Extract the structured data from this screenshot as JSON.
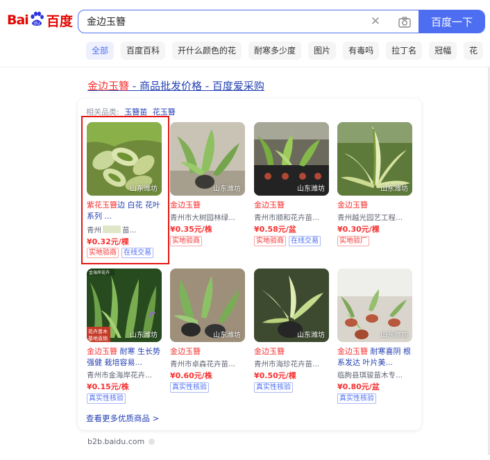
{
  "header": {
    "logo_bai": "Bai",
    "logo_du": "百度",
    "search_value": "金边玉簪",
    "search_button": "百度一下"
  },
  "tabs": [
    "全部",
    "百度百科",
    "开什么颜色的花",
    "耐寒多少度",
    "图片",
    "有毒吗",
    "拉丁名",
    "冠幅",
    "花"
  ],
  "result": {
    "title_highlight": "金边玉簪",
    "title_rest": " - 商品批发价格 - 百度爱采购",
    "related_label": "相关品类:",
    "related_items": [
      "玉簪苗",
      "花玉簪"
    ],
    "products": [
      {
        "name_red": "紫花玉簪",
        "name_rest": "边 白花 花叶系列 ...",
        "seller": "青州",
        "seller_tail": "苗...",
        "price": "¥0.32元/棵",
        "location": "山东潍坊",
        "badges": [
          {
            "text": "实地验商",
            "type": "r"
          },
          {
            "text": "在线交易",
            "type": "b"
          }
        ]
      },
      {
        "name_red": "金边玉簪",
        "name_rest": "",
        "seller": "青州市大树园林绿...",
        "price": "¥0.35元/株",
        "location": "山东潍坊",
        "badges": [
          {
            "text": "实地验商",
            "type": "r"
          }
        ]
      },
      {
        "name_red": "金边玉簪",
        "name_rest": "",
        "seller": "青州市顺和花卉苗...",
        "price": "¥0.58元/盆",
        "location": "山东潍坊",
        "badges": [
          {
            "text": "实地验商",
            "type": "r"
          },
          {
            "text": "在线交易",
            "type": "b"
          }
        ]
      },
      {
        "name_red": "金边玉簪",
        "name_rest": "",
        "seller": "青州越光园艺工程...",
        "price": "¥0.30元/棵",
        "location": "山东潍坊",
        "badges": [
          {
            "text": "实地验厂",
            "type": "r"
          }
        ]
      },
      {
        "name_red": "金边玉簪",
        "name_rest": " 耐寒 生长势强健 栽培容易...",
        "seller": "青州市金海岸花卉...",
        "price": "¥0.15元/株",
        "location": "山东潍坊",
        "badges": [
          {
            "text": "真实性核验",
            "type": "b"
          }
        ]
      },
      {
        "name_red": "金边玉簪",
        "name_rest": "",
        "seller": "青州市卓森花卉苗...",
        "price": "¥0.60元/株",
        "location": "山东潍坊",
        "badges": [
          {
            "text": "真实性核验",
            "type": "b"
          }
        ]
      },
      {
        "name_red": "金边玉簪",
        "name_rest": "",
        "seller": "青州市海珍花卉苗...",
        "price": "¥0.50元/棵",
        "location": "山东潍坊",
        "badges": [
          {
            "text": "真实性核验",
            "type": "b"
          }
        ]
      },
      {
        "name_red": "金边玉簪",
        "name_rest": " 耐寒喜阴 根系发达 叶片美...",
        "seller": "临朐县琪骏苗木专...",
        "price": "¥0.80元/盆",
        "location": "山东潍坊",
        "badges": [
          {
            "text": "真实性核验",
            "type": "b"
          }
        ]
      }
    ],
    "more_link": "查看更多优质商品 >",
    "source": "b2b.baidu.com"
  }
}
